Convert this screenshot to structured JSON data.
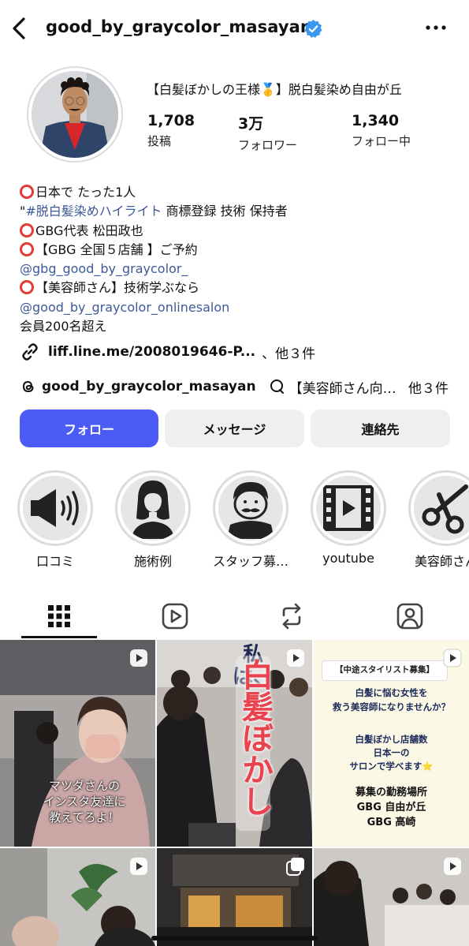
{
  "header": {
    "username": "good_by_graycolor_masayan",
    "verified": true,
    "back_icon": "chevron-left-icon",
    "more_icon": "more-horizontal-icon"
  },
  "profile": {
    "bio_title": "【白髪ぼかしの王様🥇】脱白髪染め自由が丘",
    "stats": [
      {
        "value": "1,708",
        "label": "投稿"
      },
      {
        "value": "3万",
        "label": "フォロワー"
      },
      {
        "value": "1,340",
        "label": "フォロー中"
      }
    ]
  },
  "bio": {
    "line1": "日本で たった1人",
    "line2_prefix": "\"",
    "line2_hashtag": "#脱白髪染めハイライト",
    "line2_rest": " 商標登録 技術 保持者",
    "line3": "GBG代表 松田政也",
    "line4": "【GBG 全国５店舗 】ご予約",
    "line5_link": "@gbg_good_by_graycolor_",
    "line6": "【美容師さん】技術学ぶなら",
    "line7_link": "@good_by_graycolor_onlinesalon",
    "line8": "会員200名超え"
  },
  "external_link": {
    "text": "liff.line.me/2008019646-P...",
    "suffix": "、他３件"
  },
  "threads_row": {
    "threads_handle": "good_by_graycolor_masayan",
    "group_text": "【美容師さん向…",
    "others": "他３件"
  },
  "buttons": {
    "follow": "フォロー",
    "message": "メッセージ",
    "contact": "連絡先"
  },
  "highlights": [
    {
      "label": "口コミ",
      "icon": "megaphone-icon"
    },
    {
      "label": "施術例",
      "icon": "woman-silhouette-icon"
    },
    {
      "label": "スタッフ募…",
      "icon": "man-mustache-icon"
    },
    {
      "label": "youtube",
      "icon": "film-play-icon"
    },
    {
      "label": "美容師さん",
      "icon": "scissors-icon"
    }
  ],
  "tabs": [
    {
      "name": "grid",
      "icon": "grid-icon",
      "active": true
    },
    {
      "name": "reels",
      "icon": "reels-icon",
      "active": false
    },
    {
      "name": "reposts",
      "icon": "repost-icon",
      "active": false
    },
    {
      "name": "tagged",
      "icon": "tagged-person-icon",
      "active": false
    }
  ],
  "posts": [
    {
      "caption_lines": [
        "マツダさんの",
        "インスタ友達に",
        "教えてろよ！"
      ],
      "type": "reel"
    },
    {
      "caption_lines": [
        "私は、",
        "白髪ぼかし"
      ],
      "type": "reel"
    },
    {
      "caption_lines": [
        "【中途スタイリスト募集】",
        "白髪に悩む女性を",
        "救う美容師になりませんか？",
        "白髪ぼかし店舗数",
        "日本一の",
        "サロンで学べます⭐",
        "募集の勤務場所",
        "GBG 自由が丘",
        "GBG 高崎"
      ],
      "type": "reel"
    },
    {
      "caption_lines": [],
      "type": "reel"
    },
    {
      "caption_lines": [],
      "type": "carousel"
    },
    {
      "caption_lines": [],
      "type": "reel"
    }
  ],
  "colors": {
    "follow_button": "#4a5cf5",
    "link": "#3c5a99",
    "red_circle": "#e53935",
    "verified": "#3897f0"
  }
}
